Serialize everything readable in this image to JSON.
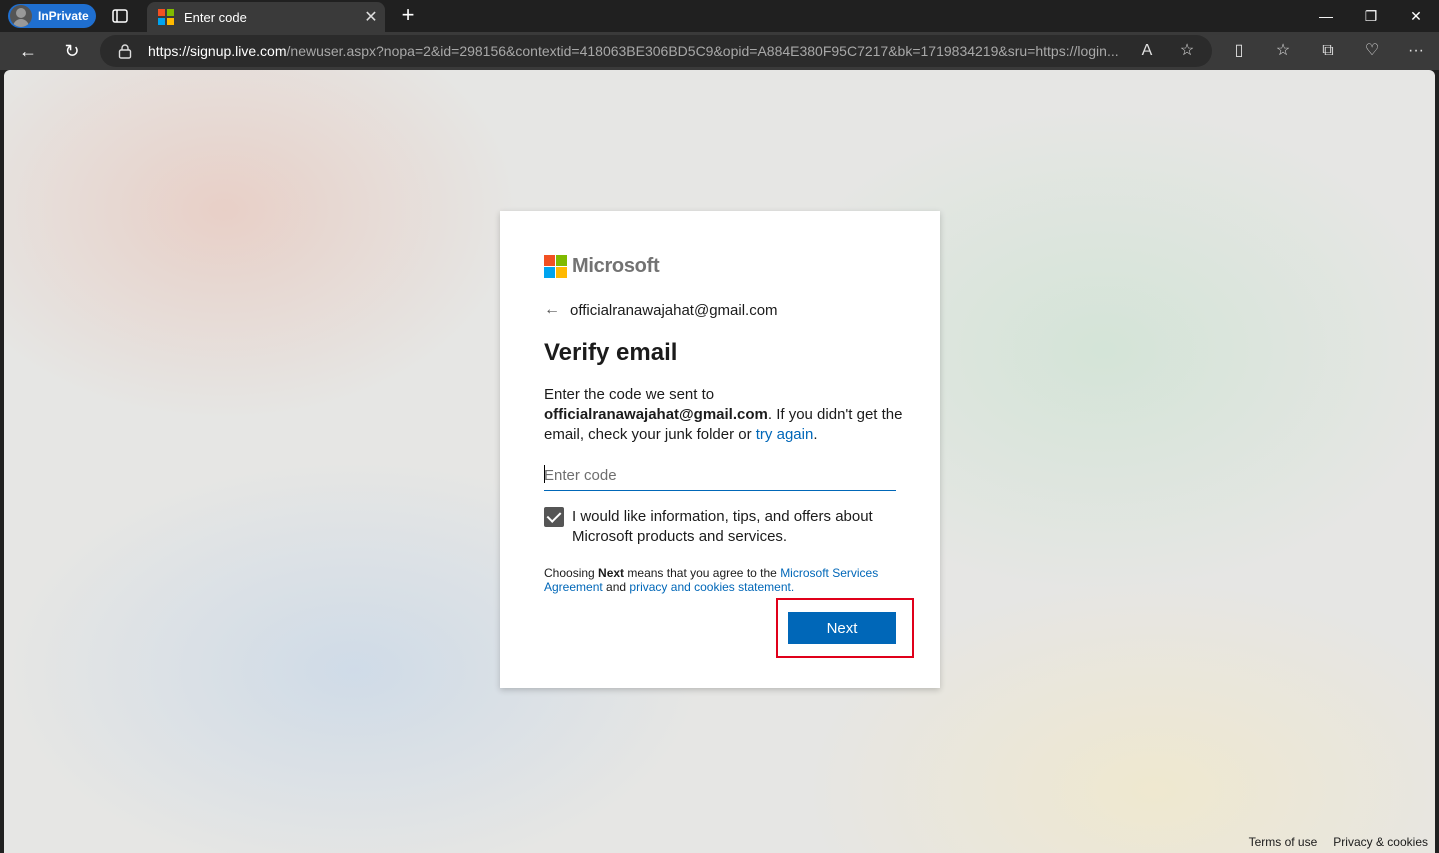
{
  "browser": {
    "profile_label": "InPrivate",
    "tab_title": "Enter code",
    "tab_close": "✕",
    "new_tab": "+",
    "url_host": "https://signup.live.com",
    "url_rest": "/newuser.aspx?nopa=2&id=298156&contextid=418063BE306BD5C9&opid=A884E380F95C7217&bk=1719834219&sru=https://login....",
    "window_controls": {
      "minimize": "—",
      "maximize": "❐",
      "close": "✕"
    },
    "nav": {
      "back": "←",
      "refresh": "↻"
    },
    "toolbar": {
      "read_aloud": "A",
      "favorite": "☆",
      "split": "▯",
      "favorites": "☆",
      "collections": "⧉",
      "performance": "♡",
      "more": "···"
    }
  },
  "card": {
    "brand": "Microsoft",
    "brand_colors": [
      "#f25022",
      "#7fba00",
      "#00a4ef",
      "#ffb900"
    ],
    "back_arrow": "←",
    "email": "officialranawajahat@gmail.com",
    "heading": "Verify email",
    "desc_pre": "Enter the code we sent to",
    "desc_email": "officialranawajahat@gmail.com",
    "desc_mid": ". If you didn't get the email, check your junk folder or",
    "desc_link": "try again",
    "desc_end": ".",
    "code_placeholder": "Enter code",
    "code_value": "",
    "checkbox_checked": true,
    "checkbox_label": "I would like information, tips, and offers about Microsoft products and services.",
    "legal_pre": "Choosing",
    "legal_bold": "Next",
    "legal_mid": "means that you agree to the",
    "legal_link1": "Microsoft Services Agreement",
    "legal_and": "and",
    "legal_link2": "privacy and cookies statement.",
    "next_label": "Next"
  },
  "footer": {
    "terms": "Terms of use",
    "privacy": "Privacy & cookies"
  },
  "colors": {
    "accent": "#0067b8",
    "highlight": "#e0001a",
    "inprivate": "#1f6fd0"
  }
}
